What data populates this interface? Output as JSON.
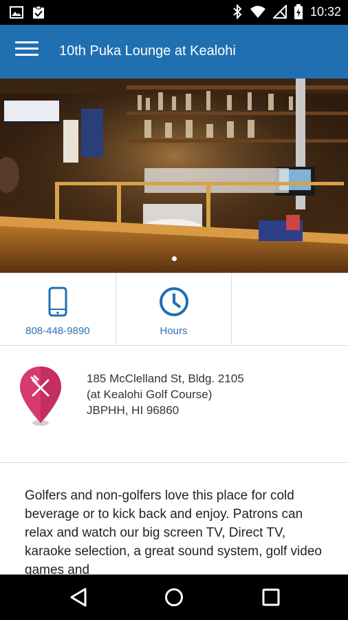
{
  "status_bar": {
    "time": "10:32",
    "left_icons": [
      "image-icon",
      "clipboard-check-icon"
    ],
    "right_icons": [
      "bluetooth-off-icon",
      "wifi-icon",
      "no-signal-icon",
      "battery-charging-icon"
    ]
  },
  "app_bar": {
    "title": "10th Puka Lounge at Kealohi",
    "menu_icon": "hamburger-menu-icon"
  },
  "hero": {
    "image_description": "bar interior photo",
    "carousel": {
      "current": 1,
      "total": 1
    }
  },
  "actions": [
    {
      "label": "808-448-9890",
      "icon": "phone-icon"
    },
    {
      "label": "Hours",
      "icon": "clock-icon"
    },
    {
      "label": "",
      "icon": ""
    }
  ],
  "address": {
    "icon": "restaurant-pin-icon",
    "line1": "185 McClelland St, Bldg. 2105",
    "line2": "(at Kealohi Golf Course)",
    "line3": "JBPHH, HI 96860"
  },
  "description": {
    "text": "Golfers and non-golfers love this place for cold beverage or to kick back and enjoy.  Patrons can relax and watch our big screen TV, Direct TV, karaoke selection, a great sound system, golf video games and"
  },
  "nav_bar": {
    "buttons": [
      "back-icon",
      "home-icon",
      "recents-icon"
    ]
  },
  "colors": {
    "app_bar": "#1f6fb1",
    "accent_text": "#2c72b0",
    "pin": "#d63a6e"
  }
}
